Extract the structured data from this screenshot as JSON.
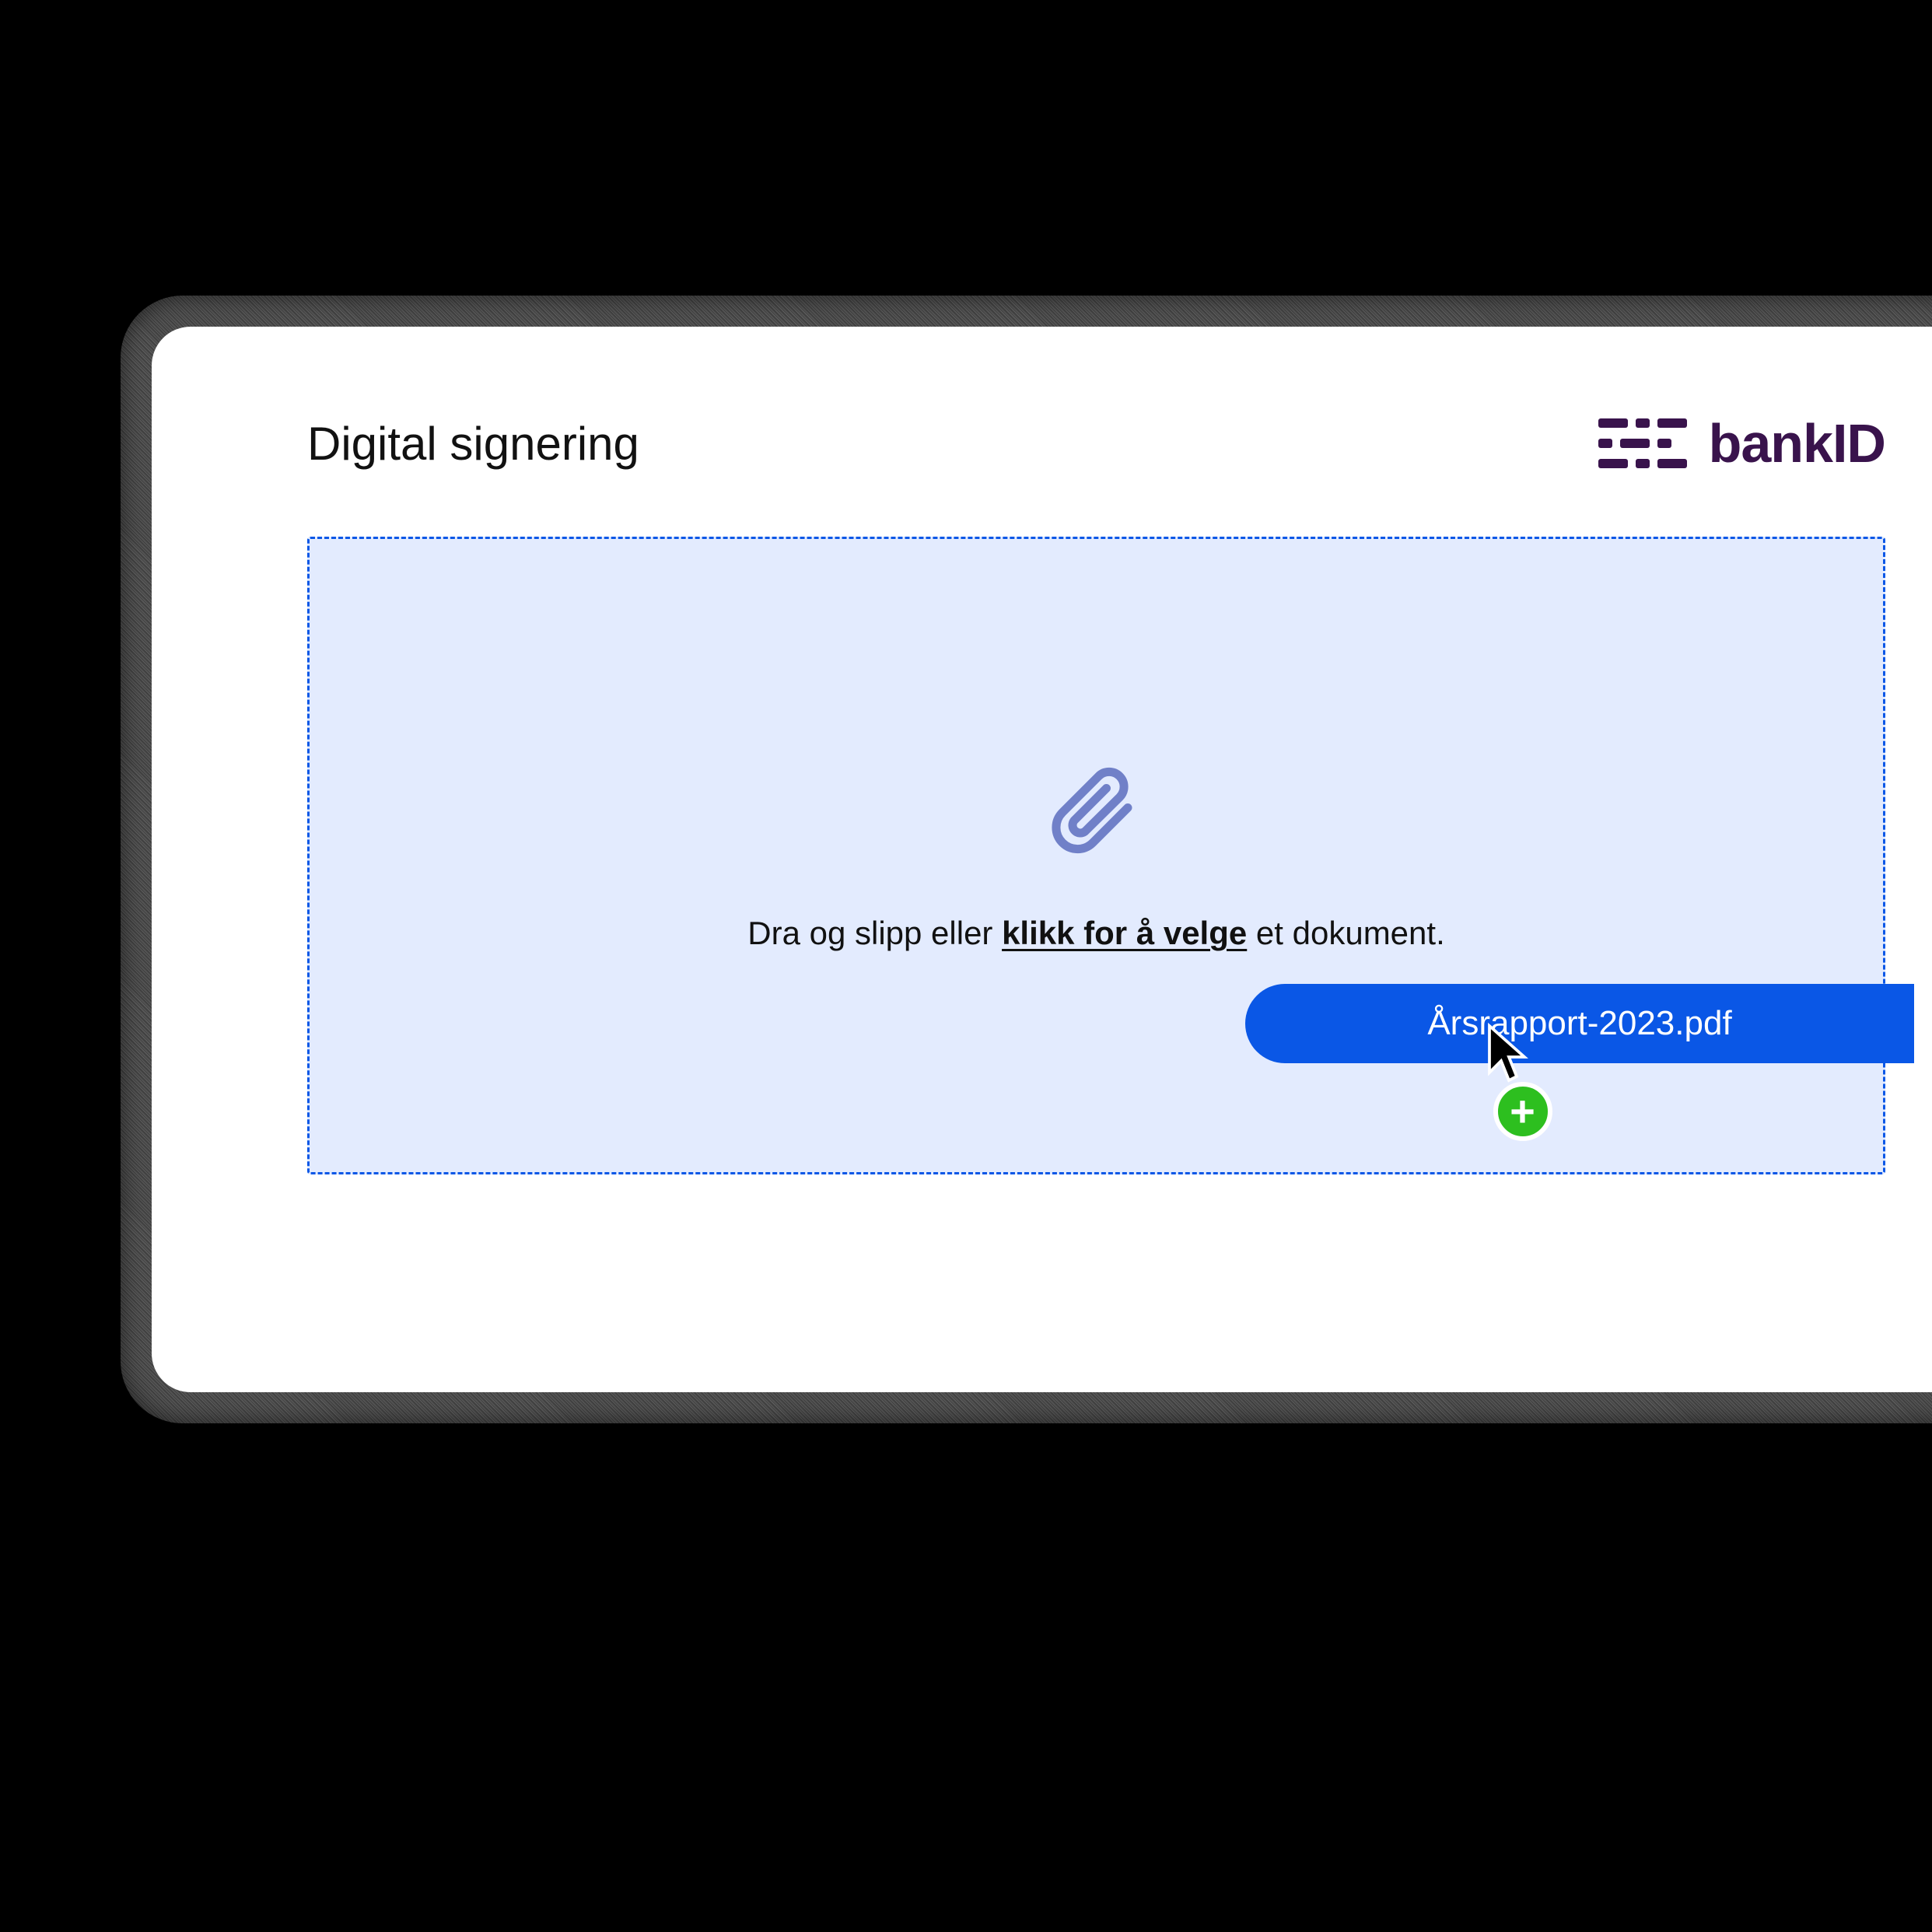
{
  "header": {
    "title": "Digital signering",
    "brand_text": "bankID"
  },
  "dropzone": {
    "text_before": "Dra og slipp eller ",
    "text_link": "klikk for å velge",
    "text_after": " et dokument.",
    "icon": "paperclip-icon"
  },
  "file": {
    "name": "Årsrapport-2023.pdf"
  },
  "cursor": {
    "badge_icon": "plus-icon"
  },
  "colors": {
    "accent_blue": "#0A57E6",
    "dropzone_bg": "#E3EBFE",
    "brand_purple": "#39134C",
    "plus_green": "#2DBF1F"
  }
}
